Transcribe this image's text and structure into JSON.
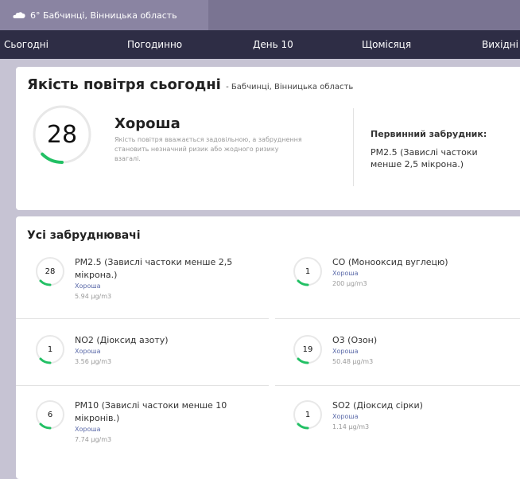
{
  "location": {
    "text": "6° Бабчинці, Вінницька область",
    "icon": "cloud-icon"
  },
  "nav": {
    "tabs": [
      "Сьогодні",
      "Погодинно",
      "День 10",
      "Щомісяця",
      "Вихідні"
    ]
  },
  "aqi": {
    "title": "Якість повітря сьогодні",
    "subtitle": "- Бабчинці, Вінницька область",
    "value": "28",
    "value_fraction": 0.06,
    "status": "Хороша",
    "description": "Якість повітря вважається задовільною, а забруднення становить незначний ризик або жодного ризику взагалі.",
    "primary_label": "Первинний забрудник:",
    "primary_value": "PM2.5 (Завислі частоки менше 2,5 мікрона.)"
  },
  "pollutants": {
    "title": "Усі забруднювачі",
    "items": [
      {
        "value": "28",
        "fraction": 0.06,
        "name": "PM2.5 (Завислі частоки менше 2,5 мікрона.)",
        "status": "Хороша",
        "amount": "5.94 µg/m3"
      },
      {
        "value": "1",
        "fraction": 0.06,
        "name": "CO (Монооксид вуглецю)",
        "status": "Хороша",
        "amount": "200 µg/m3"
      },
      {
        "value": "1",
        "fraction": 0.06,
        "name": "NO2 (Діоксид азоту)",
        "status": "Хороша",
        "amount": "3.56 µg/m3"
      },
      {
        "value": "19",
        "fraction": 0.06,
        "name": "O3 (Озон)",
        "status": "Хороша",
        "amount": "50.48 µg/m3"
      },
      {
        "value": "6",
        "fraction": 0.06,
        "name": "PM10 (Завислі частоки менше 10 мікронів.)",
        "status": "Хороша",
        "amount": "7.74 µg/m3"
      },
      {
        "value": "1",
        "fraction": 0.06,
        "name": "SO2 (Діоксид сірки)",
        "status": "Хороша",
        "amount": "1.14 µg/m3"
      }
    ]
  },
  "colors": {
    "good": "#22c064",
    "ring": "#e8e8e8",
    "nav_bg": "#2e2d45",
    "status_text": "#5a69a8"
  }
}
